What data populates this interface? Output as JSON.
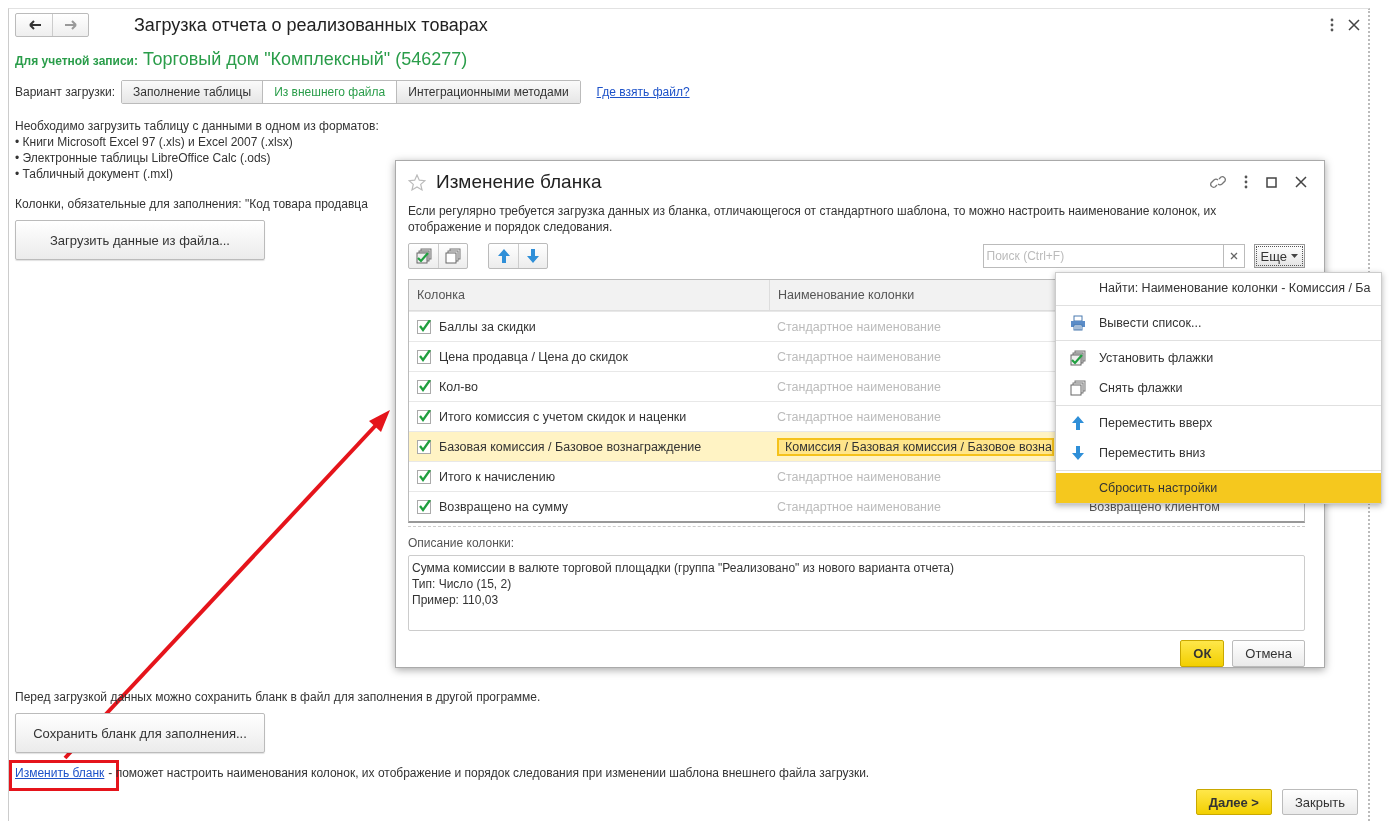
{
  "window": {
    "title": "Загрузка отчета о реализованных товарах"
  },
  "account": {
    "label": "Для учетной записи:",
    "name": "Торговый дом \"Комплексный\" (546277)"
  },
  "load_variant": {
    "label": "Вариант загрузки:",
    "options": [
      {
        "label": "Заполнение таблицы",
        "selected": false
      },
      {
        "label": "Из внешнего файла",
        "selected": true
      },
      {
        "label": "Интеграционными методами",
        "selected": false
      }
    ],
    "help_link": "Где взять файл?"
  },
  "formats_intro": "Необходимо загрузить таблицу с данными в одном из форматов:",
  "formats": [
    "• Книги Microsoft Excel 97 (.xls) и Excel 2007 (.xlsx)",
    "• Электронные таблицы LibreOffice Calc (.ods)",
    "• Табличный документ (.mxl)"
  ],
  "required_columns": "Колонки, обязательные для заполнения: \"Код товара продавца",
  "load_button": "Загрузить данные из файла...",
  "save_hint": "Перед загрузкой данных можно сохранить бланк в файл для заполнения в другой программе.",
  "save_button": "Сохранить бланк для заполнения...",
  "edit_link": "Изменить бланк",
  "edit_hint": "- поможет настроить наименования колонок, их отображение и порядок следования при изменении шаблона внешнего файла загрузки.",
  "buttons": [
    {
      "label": "Далее >",
      "kind": "primary"
    },
    {
      "label": "Закрыть",
      "kind": "default"
    }
  ],
  "dialog": {
    "title": "Изменение бланка",
    "description": "Если  регулярно требуется загрузка данных из бланка, отличающегося от стандартного шаблона, то можно настроить наименование колонок, их отображение и порядок следования.",
    "search": {
      "placeholder": "Поиск (Ctrl+F)"
    },
    "more_button": "Еще",
    "table": {
      "columns": [
        "Колонка",
        "Наименование колонки"
      ],
      "rows": [
        {
          "checked": true,
          "name": "Баллы за скидки",
          "column_name": "Стандартное наименование",
          "kind": "standard",
          "selected": false
        },
        {
          "checked": true,
          "name": "Цена продавца / Цена до скидок",
          "column_name": "Стандартное наименование",
          "kind": "standard",
          "selected": false
        },
        {
          "checked": true,
          "name": "Кол-во",
          "column_name": "Стандартное наименование",
          "kind": "standard",
          "selected": false
        },
        {
          "checked": true,
          "name": "Итого комиссия с учетом скидок и наценки",
          "column_name": "Стандартное наименование",
          "kind": "standard",
          "selected": false
        },
        {
          "checked": true,
          "name": "Базовая комиссия / Базовое вознаграждение",
          "column_name": "Комиссия / Базовая комиссия / Базовое возна",
          "kind": "custom",
          "selected": true
        },
        {
          "checked": true,
          "name": "Итого к начислению",
          "column_name": "Стандартное наименование",
          "kind": "standard",
          "selected": false
        },
        {
          "checked": true,
          "name": "Возвращено на сумму",
          "column_name": "Стандартное наименование",
          "kind": "standard",
          "selected": false,
          "column_3": "Возвращено клиентом"
        }
      ]
    },
    "description_label": "Описание колонки:",
    "description_lines": [
      "Сумма комиссии в валюте торговой площадки (группа \"Реализовано\" из нового варианта отчета)",
      "Тип: Число (15, 2)",
      "Пример: 110,03"
    ],
    "buttons": [
      {
        "label": "ОК",
        "kind": "primary"
      },
      {
        "label": "Отмена",
        "kind": "default"
      }
    ]
  },
  "context_menu": {
    "items": [
      {
        "label": "Найти: Наименование колонки - Комиссия / Ба",
        "kind": "find",
        "separator_before": false,
        "selected": false
      },
      {
        "label": "Вывести список...",
        "kind": "print",
        "separator_before": true,
        "selected": false
      },
      {
        "label": "Установить флажки",
        "kind": "check-all",
        "separator_before": true,
        "selected": false
      },
      {
        "label": "Снять флажки",
        "kind": "uncheck-all",
        "separator_before": false,
        "selected": false
      },
      {
        "label": "Переместить вверх",
        "kind": "move-up",
        "separator_before": true,
        "selected": false
      },
      {
        "label": "Переместить вниз",
        "kind": "move-down",
        "separator_before": false,
        "selected": false
      },
      {
        "label": "Сбросить настройки",
        "kind": "reset",
        "separator_before": true,
        "selected": true
      }
    ]
  }
}
